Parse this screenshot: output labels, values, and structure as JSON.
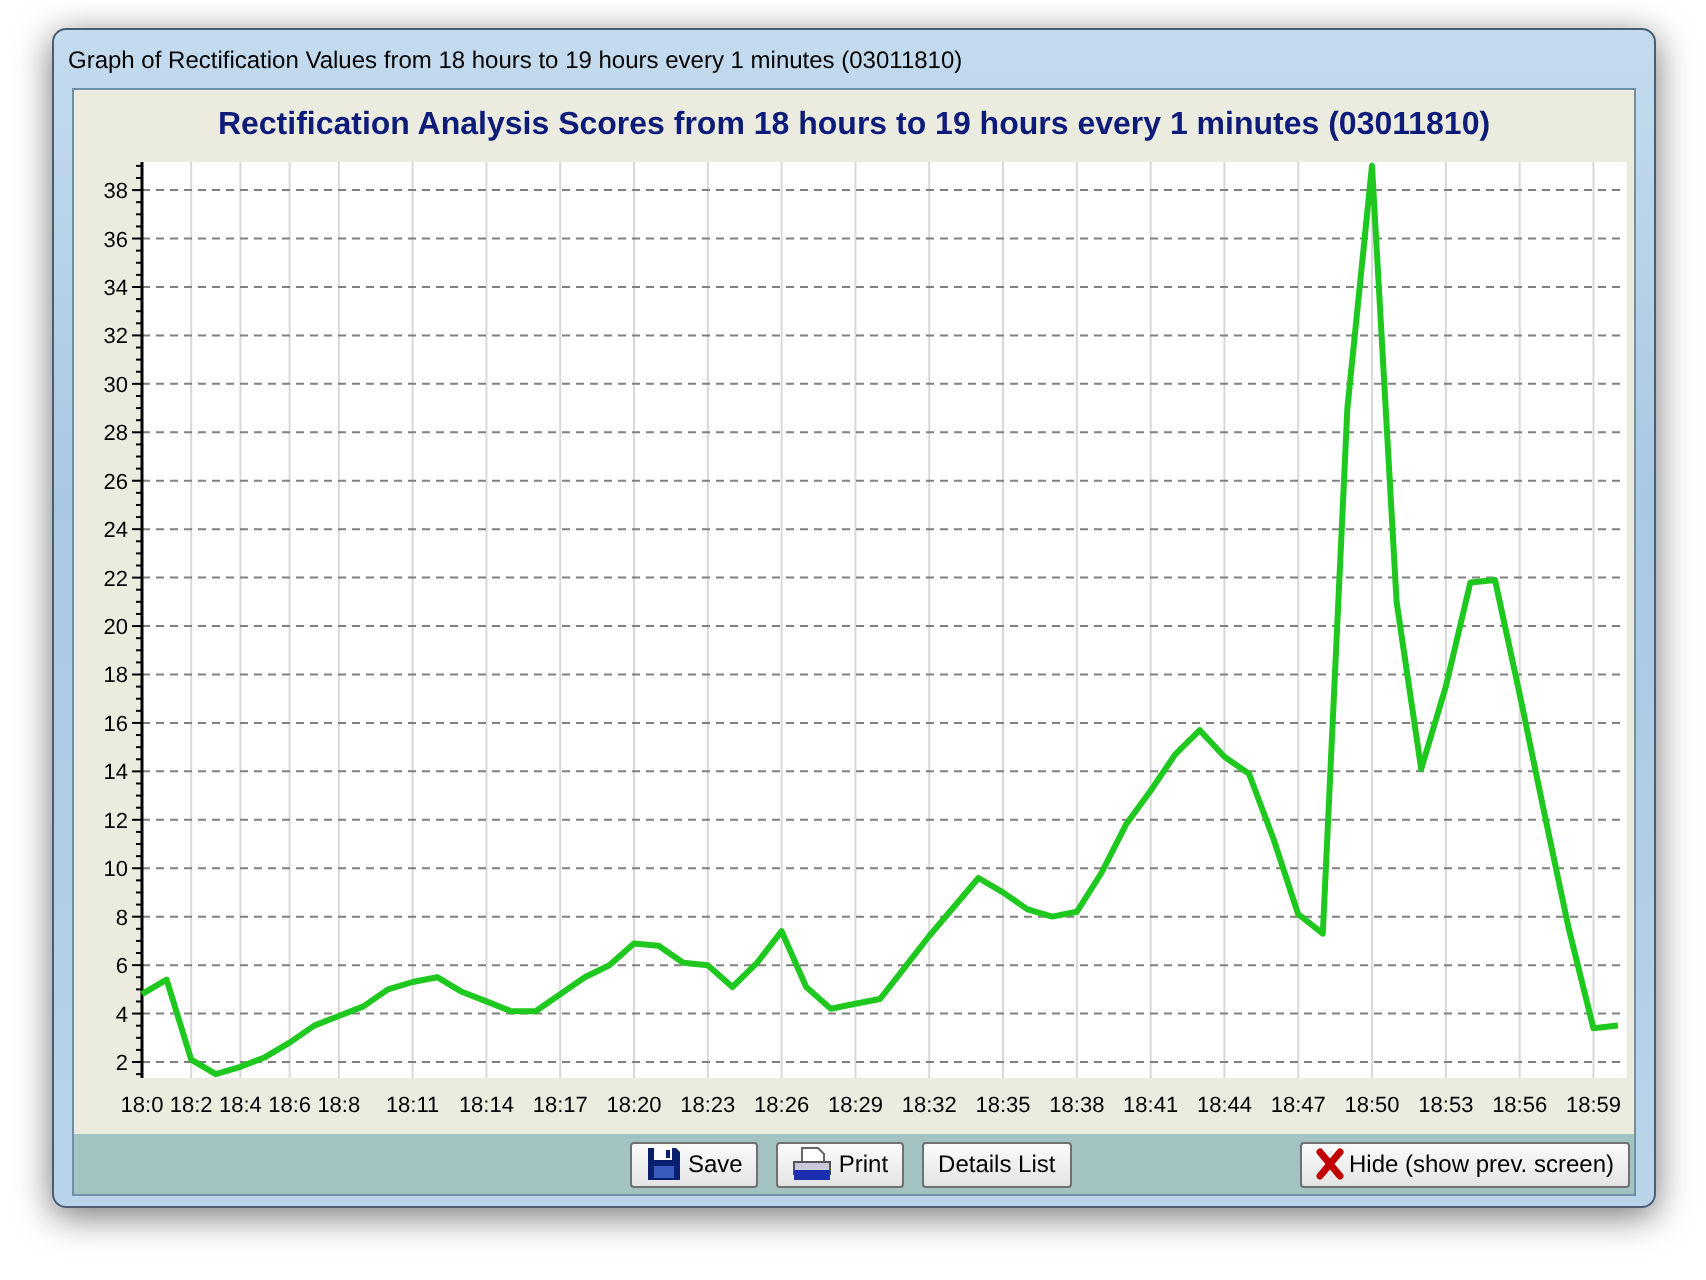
{
  "window": {
    "title": "Graph of Rectification Values from 18 hours to 19 hours every 1 minutes (03011810)"
  },
  "chart": {
    "chart_data": {
      "type": "line",
      "title": "Rectification Analysis Scores from 18 hours to 19 hours every 1 minutes (03011810)",
      "categories": [
        "18:0",
        null,
        "18:2",
        null,
        "18:4",
        null,
        "18:6",
        null,
        "18:8",
        null,
        null,
        "18:11",
        null,
        null,
        "18:14",
        null,
        null,
        "18:17",
        null,
        null,
        "18:20",
        null,
        null,
        "18:23",
        null,
        null,
        "18:26",
        null,
        null,
        "18:29",
        null,
        null,
        "18:32",
        null,
        null,
        "18:35",
        null,
        null,
        "18:38",
        null,
        null,
        "18:41",
        null,
        null,
        "18:44",
        null,
        null,
        "18:47",
        null,
        null,
        "18:50",
        null,
        null,
        "18:53",
        null,
        null,
        "18:56",
        null,
        null,
        "18:59",
        null
      ],
      "series": [
        {
          "color": "#1ec81e",
          "values": [
            4.8,
            5.4,
            2.1,
            1.5,
            1.8,
            2.2,
            2.8,
            3.5,
            3.9,
            4.3,
            5.0,
            5.3,
            5.5,
            4.9,
            4.5,
            4.1,
            4.1,
            4.8,
            5.5,
            6.0,
            6.9,
            6.8,
            6.1,
            6.0,
            5.1,
            6.1,
            7.4,
            5.1,
            4.2,
            4.4,
            4.6,
            5.9,
            7.2,
            8.4,
            9.6,
            9.0,
            8.3,
            8.0,
            8.2,
            9.8,
            11.8,
            13.2,
            14.7,
            15.7,
            14.6,
            13.9,
            11.2,
            8.1,
            7.3,
            29.0,
            39.0,
            21.0,
            14.1,
            17.5,
            21.8,
            21.9,
            17.2,
            12.3,
            7.5,
            3.4,
            3.5
          ]
        }
      ],
      "ylim": [
        1.34,
        39.16
      ],
      "grid": true,
      "yticks": [
        2,
        4,
        6,
        8,
        10,
        12,
        14,
        16,
        18,
        20,
        22,
        24,
        26,
        28,
        30,
        32,
        34,
        36,
        38
      ]
    }
  },
  "buttons": [
    {
      "kind": "save",
      "label": "Save"
    },
    {
      "kind": "print",
      "label": "Print"
    },
    {
      "kind": "details",
      "label": "Details List"
    },
    {
      "kind": "hide",
      "label": "Hide (show prev. screen)"
    }
  ]
}
